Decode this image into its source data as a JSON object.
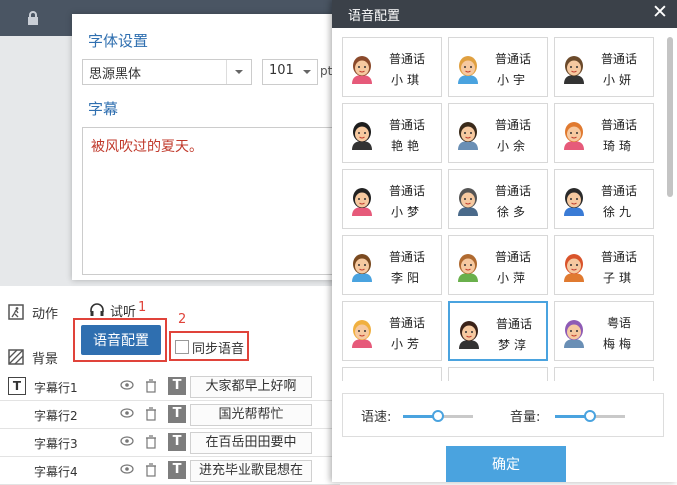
{
  "font_panel": {
    "title": "字体设置",
    "font_family": "思源黑体",
    "font_size": "101",
    "size_unit": "pt",
    "subtitle_section": "字幕",
    "subtitle_text": "被风吹过的夏天。",
    "listen_label": "试听",
    "voice_config_button": "语音配置",
    "sync_voice_label": "同步语音",
    "marker_1": "1",
    "marker_2": "2"
  },
  "side_nav": {
    "items": [
      {
        "label": "动作",
        "icon": "action-icon"
      },
      {
        "label": "背景",
        "icon": "background-icon"
      }
    ]
  },
  "tracks": [
    {
      "label": "字幕行1",
      "text": "大家都早上好啊"
    },
    {
      "label": "字幕行2",
      "text": "国光帮帮忙"
    },
    {
      "label": "字幕行3",
      "text": "在百岳田田要中"
    },
    {
      "label": "字幕行4",
      "text": "进充毕业歌昆想在"
    }
  ],
  "track_type_glyph": "T",
  "dialog": {
    "title": "语音配置",
    "close_glyph": "✕",
    "voices": [
      {
        "lang": "普通话",
        "name": "小琪",
        "icon": "girl-brown-hair-avatar"
      },
      {
        "lang": "普通话",
        "name": "小宇",
        "icon": "boy-blond-avatar"
      },
      {
        "lang": "普通话",
        "name": "小妍",
        "icon": "man-glasses-suit-avatar"
      },
      {
        "lang": "普通话",
        "name": "艳艳",
        "icon": "woman-headset-avatar"
      },
      {
        "lang": "普通话",
        "name": "小余",
        "icon": "man-tie-avatar"
      },
      {
        "lang": "普通话",
        "name": "琦琦",
        "icon": "girl-orange-hair-avatar"
      },
      {
        "lang": "普通话",
        "name": "小梦",
        "icon": "girl-black-hair-avatar"
      },
      {
        "lang": "普通话",
        "name": "徐多",
        "icon": "man-mustache-avatar"
      },
      {
        "lang": "普通话",
        "name": "徐九",
        "icon": "boy-cap-avatar"
      },
      {
        "lang": "普通话",
        "name": "李阳",
        "icon": "boy-glasses-avatar"
      },
      {
        "lang": "普通话",
        "name": "小萍",
        "icon": "girl-glasses-avatar"
      },
      {
        "lang": "普通话",
        "name": "子琪",
        "icon": "girl-red-hair-avatar"
      },
      {
        "lang": "普通话",
        "name": "小芳",
        "icon": "girl-blonde-avatar"
      },
      {
        "lang": "普通话",
        "name": "梦淳",
        "icon": "woman-long-hair-avatar"
      },
      {
        "lang": "粤语",
        "name": "梅梅",
        "icon": "woman-purple-hair-avatar"
      }
    ],
    "selected_index": 13,
    "speed_label": "语速:",
    "volume_label": "音量:",
    "speed_level": 0.5,
    "volume_level": 0.5,
    "confirm_button": "确定"
  },
  "colors": {
    "accent": "#4aa3df",
    "primary_button": "#2f6fb0",
    "annotation_red": "#e0433a",
    "header_dark": "#3b4149"
  }
}
